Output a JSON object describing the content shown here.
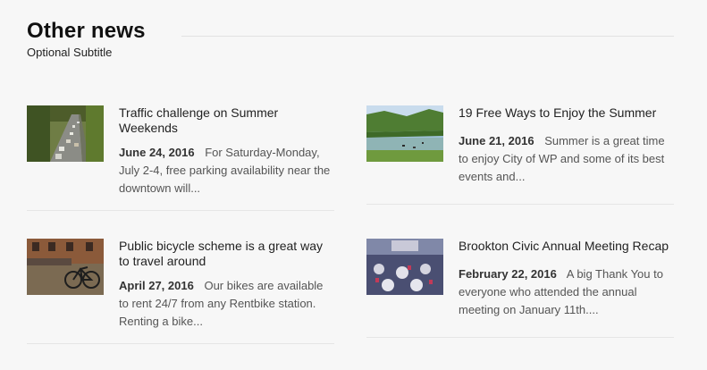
{
  "section": {
    "title": "Other news",
    "subtitle": "Optional Subtitle"
  },
  "news": [
    {
      "title": "Traffic challenge on Summer Weekends",
      "date": "June 24, 2016",
      "excerpt": "For Saturday-Monday, July 2-4, free parking availability near the downtown will...",
      "thumb_icon": "highway-traffic-photo"
    },
    {
      "title": "19 Free Ways to Enjoy the Summer",
      "date": "June 21, 2016",
      "excerpt": "Summer is a great time to enjoy City of WP and some of its best events and...",
      "thumb_icon": "river-kayaks-photo"
    },
    {
      "title": "Public bicycle scheme is a great way to travel around",
      "date": "April 27, 2016",
      "excerpt": "Our bikes are available to rent 24/7 from any Rentbike station. Renting a bike...",
      "thumb_icon": "parked-bicycle-photo"
    },
    {
      "title": "Brookton Civic Annual Meeting Recap",
      "date": "February 22, 2016",
      "excerpt": "A big Thank You to everyone who attended the annual meeting on January 11th....",
      "thumb_icon": "conference-hall-photo"
    }
  ]
}
